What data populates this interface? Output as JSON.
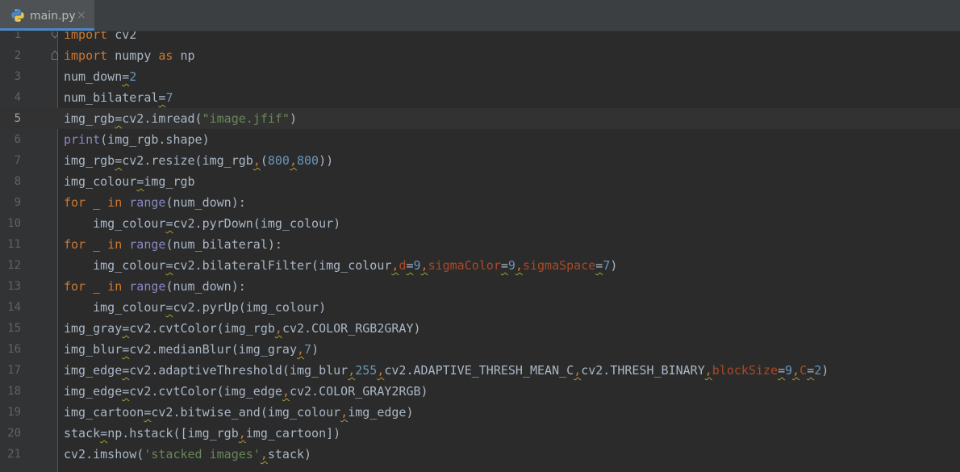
{
  "tab": {
    "filename": "main.py",
    "close_glyph": "×",
    "icon": "python-file-icon"
  },
  "colors": {
    "background": "#2b2b2b",
    "keyword": "#cc7832",
    "number": "#6897bb",
    "string": "#6a8759",
    "builtin": "#8888c6",
    "param": "#aa4926",
    "text": "#a9b7c6"
  },
  "editor": {
    "current_line": 5,
    "lines": [
      {
        "n": "1",
        "code": "import cv2"
      },
      {
        "n": "2",
        "code": "import numpy as np"
      },
      {
        "n": "3",
        "code": "num_down=2"
      },
      {
        "n": "4",
        "code": "num_bilateral=7"
      },
      {
        "n": "5",
        "code": "img_rgb=cv2.imread(\"image.jfif\")"
      },
      {
        "n": "6",
        "code": "print(img_rgb.shape)"
      },
      {
        "n": "7",
        "code": "img_rgb=cv2.resize(img_rgb,(800,800))"
      },
      {
        "n": "8",
        "code": "img_colour=img_rgb"
      },
      {
        "n": "9",
        "code": "for _ in range(num_down):"
      },
      {
        "n": "10",
        "code": "    img_colour=cv2.pyrDown(img_colour)"
      },
      {
        "n": "11",
        "code": "for _ in range(num_bilateral):"
      },
      {
        "n": "12",
        "code": "    img_colour=cv2.bilateralFilter(img_colour,d=9,sigmaColor=9,sigmaSpace=7)"
      },
      {
        "n": "13",
        "code": "for _ in range(num_down):"
      },
      {
        "n": "14",
        "code": "    img_colour=cv2.pyrUp(img_colour)"
      },
      {
        "n": "15",
        "code": "img_gray=cv2.cvtColor(img_rgb,cv2.COLOR_RGB2GRAY)"
      },
      {
        "n": "16",
        "code": "img_blur=cv2.medianBlur(img_gray,7)"
      },
      {
        "n": "17",
        "code": "img_edge=cv2.adaptiveThreshold(img_blur,255,cv2.ADAPTIVE_THRESH_MEAN_C,cv2.THRESH_BINARY,blockSize=9,C=2)"
      },
      {
        "n": "18",
        "code": "img_edge=cv2.cvtColor(img_edge,cv2.COLOR_GRAY2RGB)"
      },
      {
        "n": "19",
        "code": "img_cartoon=cv2.bitwise_and(img_colour,img_edge)"
      },
      {
        "n": "20",
        "code": "stack=np.hstack([img_rgb,img_cartoon])"
      },
      {
        "n": "21",
        "code": "cv2.imshow('stacked images',stack)"
      }
    ]
  }
}
